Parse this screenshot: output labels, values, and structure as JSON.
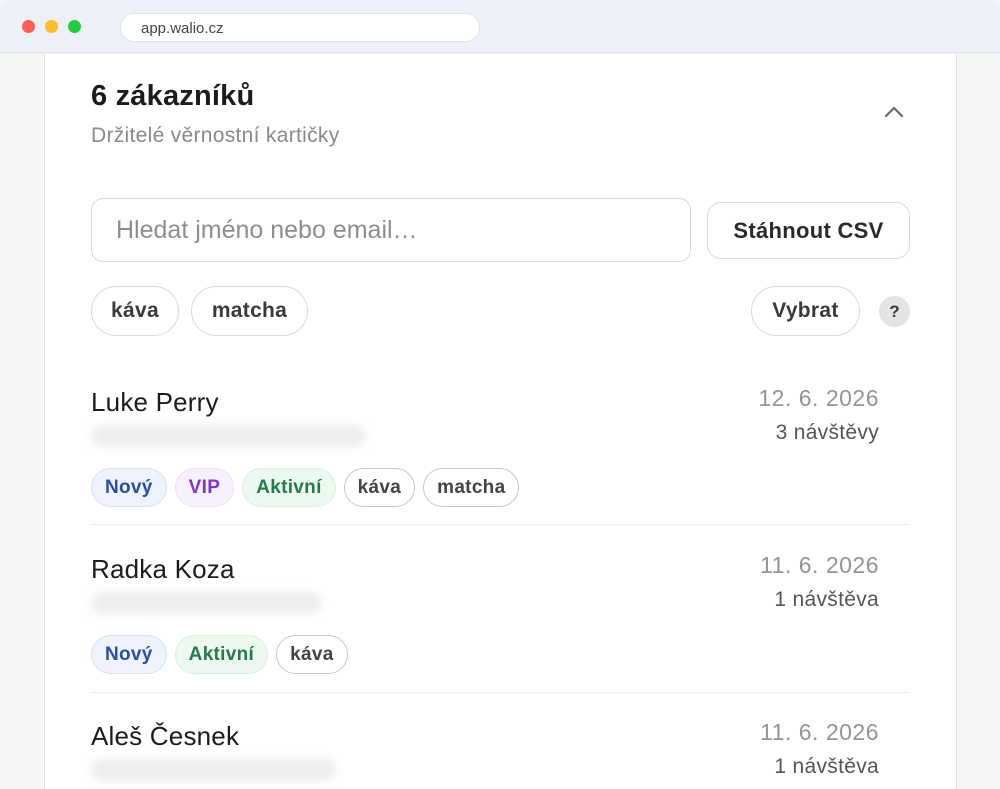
{
  "browser": {
    "url": "app.walio.cz"
  },
  "header": {
    "title": "6 zákazníků",
    "subtitle": "Držitelé věrnostní kartičky",
    "collapse_icon": "chevron-up-icon"
  },
  "search": {
    "placeholder": "Hledat jméno nebo email…",
    "value": ""
  },
  "toolbar": {
    "csv_label": "Stáhnout CSV",
    "select_label": "Vybrat",
    "help_label": "?"
  },
  "filters": [
    {
      "label": "káva"
    },
    {
      "label": "matcha"
    }
  ],
  "colors": {
    "tag_blue": "#2b4f9c",
    "tag_purple": "#7b37c4",
    "tag_green": "#26794a"
  },
  "customers": [
    {
      "name": "Luke Perry",
      "date": "12. 6. 2026",
      "visits": "3 návštěvy",
      "tags": [
        {
          "label": "Nový",
          "style": "blue"
        },
        {
          "label": "VIP",
          "style": "purple"
        },
        {
          "label": "Aktivní",
          "style": "green"
        },
        {
          "label": "káva",
          "style": "plain"
        },
        {
          "label": "matcha",
          "style": "plain"
        }
      ]
    },
    {
      "name": "Radka Koza",
      "date": "11. 6. 2026",
      "visits": "1 návštěva",
      "tags": [
        {
          "label": "Nový",
          "style": "blue"
        },
        {
          "label": "Aktivní",
          "style": "green"
        },
        {
          "label": "káva",
          "style": "plain"
        }
      ]
    },
    {
      "name": "Aleš Česnek",
      "date": "11. 6. 2026",
      "visits": "1 návštěva",
      "tags": []
    }
  ]
}
